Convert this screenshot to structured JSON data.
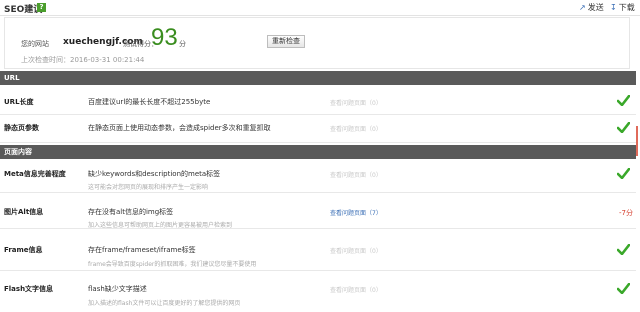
{
  "header": {
    "title": "SEO建议",
    "badge": "?",
    "actions": [
      {
        "icon": "share-icon",
        "label": "发送"
      },
      {
        "icon": "download-icon",
        "label": "下载"
      }
    ]
  },
  "summary": {
    "site_label": "您的网站",
    "site_value": "xuechengjf.com",
    "score_label": "测试得分：",
    "score_value": "93",
    "score_unit": "分",
    "recheck_button": "重新检查",
    "last_check": "上次检查时间：2016-03-31 00:21:44"
  },
  "sections": [
    {
      "title": "URL"
    },
    {
      "title": "页面内容"
    }
  ],
  "rows": [
    {
      "name": "URL长度",
      "desc": "百度建议url的最长长度不超过255byte",
      "sub": "",
      "link": "查看问题页面（0）",
      "link_active": false,
      "status": "pass",
      "penalty": ""
    },
    {
      "name": "静态页参数",
      "desc": "在静态页面上使用动态参数，会造成spider多次和重复抓取",
      "sub": "",
      "link": "查看问题页面（0）",
      "link_active": false,
      "status": "pass",
      "penalty": ""
    },
    {
      "name": "Meta信息完善程度",
      "desc": "缺少keywords和description的meta标签",
      "sub": "这可能会对您网页的展现和排序产生一定影响",
      "link": "查看问题页面（0）",
      "link_active": false,
      "status": "pass",
      "penalty": ""
    },
    {
      "name": "图片Alt信息",
      "desc": "存在没有alt信息的img标签",
      "sub": "加入这些信息可帮助网页上的图片更容易被用户检索到",
      "link": "查看问题页面（7）",
      "link_active": true,
      "status": "fail",
      "penalty": "-7分"
    },
    {
      "name": "Frame信息",
      "desc": "存在frame/frameset/iframe标签",
      "sub": "frame会导致百度spider的抓取困难，我们建议您尽量不要使用",
      "link": "查看问题页面（0）",
      "link_active": false,
      "status": "pass",
      "penalty": ""
    },
    {
      "name": "Flash文字信息",
      "desc": "flash缺少文字描述",
      "sub": "加入描述的flash文件可以让百度更好的了解您提供的网页",
      "link": "查看问题页面（0）",
      "link_active": false,
      "status": "pass",
      "penalty": ""
    }
  ],
  "colors": {
    "accent": "#3a8d1f",
    "link": "#3b6fb6",
    "penalty": "#d43a2a",
    "section_bg": "#5a5a5a"
  }
}
